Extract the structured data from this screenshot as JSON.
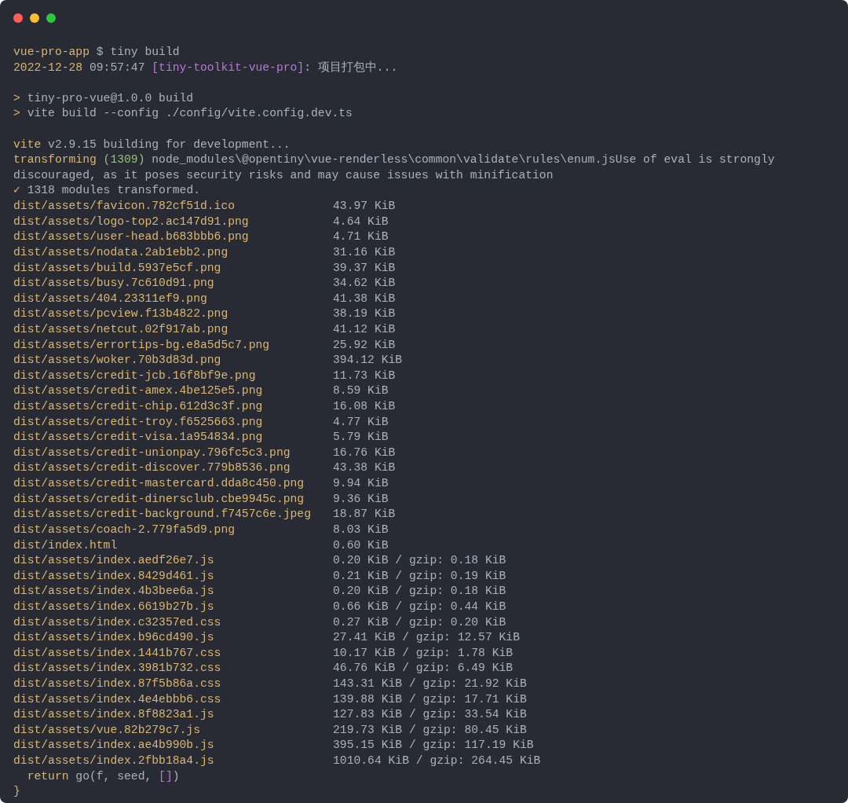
{
  "window_controls": [
    {
      "color": "#ff5f57"
    },
    {
      "color": "#febc2e"
    },
    {
      "color": "#28c840"
    }
  ],
  "blocks": [
    {
      "lines": [
        [
          {
            "text": "vue-pro-app",
            "kind": "accent"
          },
          {
            "text": " $ tiny build",
            "kind": "plain"
          }
        ],
        [
          {
            "text": "2022-12-28",
            "kind": "accent"
          },
          {
            "text": " 09:57:47 ",
            "kind": "plain"
          },
          {
            "text": "[tiny-toolkit-vue-pro]",
            "kind": "tag"
          },
          {
            "text": ": 项目打包中...",
            "kind": "plain"
          }
        ]
      ]
    },
    {
      "lines": [
        [
          {
            "text": ">",
            "kind": "accent"
          },
          {
            "text": " tiny-pro-vue@1.0.0 build",
            "kind": "plain"
          }
        ],
        [
          {
            "text": ">",
            "kind": "accent"
          },
          {
            "text": " vite build --config ./config/vite.config.dev.ts",
            "kind": "plain"
          }
        ]
      ]
    },
    {
      "lines": [
        [
          {
            "text": "vite",
            "kind": "accent"
          },
          {
            "text": " v2.9.15 building for development...",
            "kind": "plain"
          }
        ],
        [
          {
            "text": "transforming ",
            "kind": "accent"
          },
          {
            "text": "(1309)",
            "kind": "count"
          },
          {
            "text": " node_modules\\@opentiny\\vue-renderless\\common\\validate\\rules\\enum.jsUse of eval is strongly",
            "kind": "plain"
          }
        ],
        [
          {
            "text": "discouraged, as it poses security risks and may cause issues with minification",
            "kind": "plain"
          }
        ],
        [
          {
            "text": "✓",
            "kind": "accent"
          },
          {
            "text": " 1318 modules transformed.",
            "kind": "plain"
          }
        ]
      ]
    }
  ],
  "assets": [
    {
      "file": "dist/assets/favicon.782cf51d.ico",
      "size": "43.97 KiB"
    },
    {
      "file": "dist/assets/logo-top2.ac147d91.png",
      "size": "4.64 KiB"
    },
    {
      "file": "dist/assets/user-head.b683bbb6.png",
      "size": "4.71 KiB"
    },
    {
      "file": "dist/assets/nodata.2ab1ebb2.png",
      "size": "31.16 KiB"
    },
    {
      "file": "dist/assets/build.5937e5cf.png",
      "size": "39.37 KiB"
    },
    {
      "file": "dist/assets/busy.7c610d91.png",
      "size": "34.62 KiB"
    },
    {
      "file": "dist/assets/404.23311ef9.png",
      "size": "41.38 KiB"
    },
    {
      "file": "dist/assets/pcview.f13b4822.png",
      "size": "38.19 KiB"
    },
    {
      "file": "dist/assets/netcut.02f917ab.png",
      "size": "41.12 KiB"
    },
    {
      "file": "dist/assets/errortips-bg.e8a5d5c7.png",
      "size": "25.92 KiB"
    },
    {
      "file": "dist/assets/woker.70b3d83d.png",
      "size": "394.12 KiB"
    },
    {
      "file": "dist/assets/credit-jcb.16f8bf9e.png",
      "size": "11.73 KiB"
    },
    {
      "file": "dist/assets/credit-amex.4be125e5.png",
      "size": "8.59 KiB"
    },
    {
      "file": "dist/assets/credit-chip.612d3c3f.png",
      "size": "16.08 KiB"
    },
    {
      "file": "dist/assets/credit-troy.f6525663.png",
      "size": "4.77 KiB"
    },
    {
      "file": "dist/assets/credit-visa.1a954834.png",
      "size": "5.79 KiB"
    },
    {
      "file": "dist/assets/credit-unionpay.796fc5c3.png",
      "size": "16.76 KiB"
    },
    {
      "file": "dist/assets/credit-discover.779b8536.png",
      "size": "43.38 KiB"
    },
    {
      "file": "dist/assets/credit-mastercard.dda8c450.png",
      "size": "9.94 KiB"
    },
    {
      "file": "dist/assets/credit-dinersclub.cbe9945c.png",
      "size": "9.36 KiB"
    },
    {
      "file": "dist/assets/credit-background.f7457c6e.jpeg",
      "size": "18.87 KiB"
    },
    {
      "file": "dist/assets/coach-2.779fa5d9.png",
      "size": "8.03 KiB"
    },
    {
      "file": "dist/index.html",
      "size": "0.60 KiB"
    },
    {
      "file": "dist/assets/index.aedf26e7.js",
      "size": "0.20 KiB / gzip: 0.18 KiB"
    },
    {
      "file": "dist/assets/index.8429d461.js",
      "size": "0.21 KiB / gzip: 0.19 KiB"
    },
    {
      "file": "dist/assets/index.4b3bee6a.js",
      "size": "0.20 KiB / gzip: 0.18 KiB"
    },
    {
      "file": "dist/assets/index.6619b27b.js",
      "size": "0.66 KiB / gzip: 0.44 KiB"
    },
    {
      "file": "dist/assets/index.c32357ed.css",
      "size": "0.27 KiB / gzip: 0.20 KiB"
    },
    {
      "file": "dist/assets/index.b96cd490.js",
      "size": "27.41 KiB / gzip: 12.57 KiB"
    },
    {
      "file": "dist/assets/index.1441b767.css",
      "size": "10.17 KiB / gzip: 1.78 KiB"
    },
    {
      "file": "dist/assets/index.3981b732.css",
      "size": "46.76 KiB / gzip: 6.49 KiB"
    },
    {
      "file": "dist/assets/index.87f5b86a.css",
      "size": "143.31 KiB / gzip: 21.92 KiB"
    },
    {
      "file": "dist/assets/index.4e4ebbb6.css",
      "size": "139.88 KiB / gzip: 17.71 KiB"
    },
    {
      "file": "dist/assets/index.8f8823a1.js",
      "size": "127.83 KiB / gzip: 33.54 KiB"
    },
    {
      "file": "dist/assets/vue.82b279c7.js",
      "size": "219.73 KiB / gzip: 80.45 KiB"
    },
    {
      "file": "dist/assets/index.ae4b990b.js",
      "size": "395.15 KiB / gzip: 117.19 KiB"
    },
    {
      "file": "dist/assets/index.2fbb18a4.js",
      "size": "1010.64 KiB / gzip: 264.45 KiB"
    }
  ],
  "trailer": [
    [
      {
        "text": "  return",
        "kind": "accent"
      },
      {
        "text": " go(f, seed, ",
        "kind": "plain"
      },
      {
        "text": "[]",
        "kind": "tag"
      },
      {
        "text": ")",
        "kind": "plain"
      }
    ],
    [
      {
        "text": "}",
        "kind": "accent"
      }
    ]
  ]
}
